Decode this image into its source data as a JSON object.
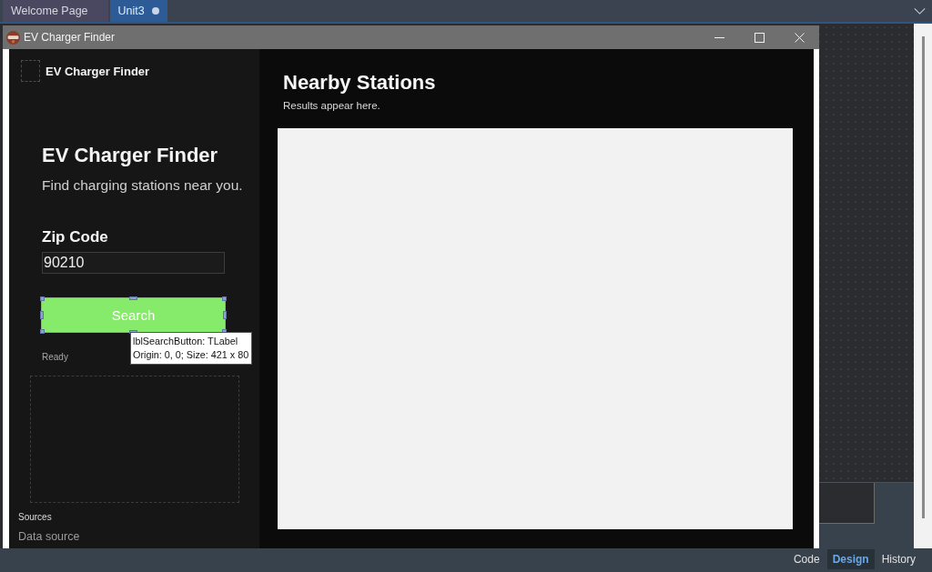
{
  "editor_tabs": [
    {
      "label": "Welcome Page",
      "selected": false,
      "modified": false
    },
    {
      "label": "Unit3",
      "selected": true,
      "modified": true
    }
  ],
  "form_window": {
    "title": "EV Charger Finder"
  },
  "sidebar": {
    "brand": "EV Charger Finder",
    "heading": "EV Charger Finder",
    "subtitle": "Find charging stations near you.",
    "zip_label": "Zip Code",
    "zip_field": {
      "value": "90210"
    },
    "search_button": {
      "label": "Search",
      "selected": true
    },
    "status": "Ready",
    "sources_label": "Sources",
    "sources_link": "Data source"
  },
  "tooltip": {
    "lines": [
      "lblSearchButton: TLabel",
      "Origin: 0, 0; Size: 421 x 80"
    ]
  },
  "results": {
    "title": "Nearby Stations",
    "subtitle": "Results appear here."
  },
  "view_tabs": [
    {
      "label": "Code",
      "selected": false
    },
    {
      "label": "Design",
      "selected": true
    },
    {
      "label": "History",
      "selected": false
    }
  ]
}
